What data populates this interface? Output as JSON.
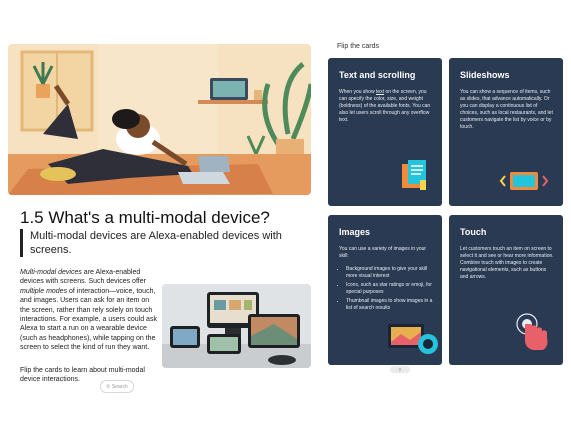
{
  "section": {
    "title": "1.5 What's a multi-modal device?",
    "subtitle": "Multi-modal devices are Alexa-enabled devices with screens.",
    "body_p1_a": "Multi-modal devices",
    "body_p1_b": " are Alexa-enabled devices with screens. Such devices offer ",
    "body_p1_c": "multiple modes",
    "body_p1_d": " of interaction—voice, touch, and images. Users can ask for an item on the screen, rather than rely solely on touch interactions. For example, a users could ask Alexa to start a run on a wearable device (such as headphones), while tapping on the screen to select the kind of run they want.",
    "body_p2": "Flip the cards to learn about multi-modal device interactions.",
    "search_label": "Search"
  },
  "cards": {
    "header": "Flip the cards",
    "text_scrolling": {
      "title": "Text and scrolling",
      "desc_a": "When you show ",
      "desc_link": "text",
      "desc_b": " on the screen, you can specify the color, size, and weight (boldness) of the available fonts. You can also let users scroll through any overflow text."
    },
    "slideshows": {
      "title": "Slideshows",
      "desc": "You can show a sequence of items, such as slides, that advance automatically. Or you can display a continuous list of choices, such as local restaurants, and let customers navigate the list by voice or by touch."
    },
    "images": {
      "title": "Images",
      "desc": "You can use a variety of images in your skill:",
      "bullets": [
        "Background images to give your skill more visual interest",
        "Icons, such as star ratings or emoji, for special purposes",
        "Thumbnail images to show images in a list of search results"
      ]
    },
    "touch": {
      "title": "Touch",
      "desc": "Let customers touch an item on screen to select it and see or hear more information. Combine touch with images to create navigational elements, such as buttons and arrows."
    }
  },
  "colors": {
    "card_bg": "#2a3a52",
    "accent_orange": "#f08a3c",
    "accent_cyan": "#23c4dc",
    "accent_pink": "#e8616a"
  }
}
